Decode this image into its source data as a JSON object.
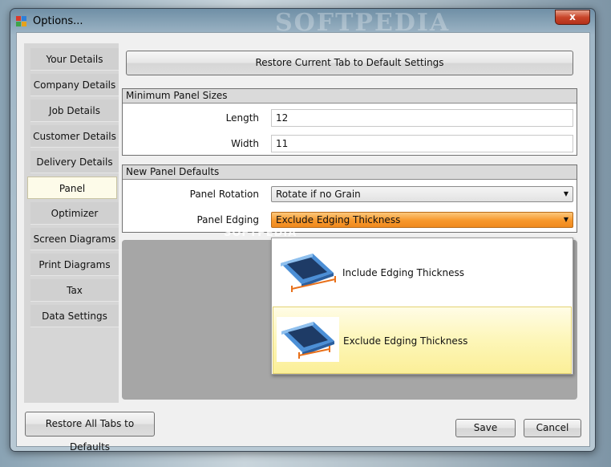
{
  "window": {
    "title": "Options...",
    "title_watermark": "SOFTPEDIA",
    "close_label": "x"
  },
  "sidebar": {
    "items": [
      {
        "label": "Your Details",
        "active": false
      },
      {
        "label": "Company Details",
        "active": false
      },
      {
        "label": "Job Details",
        "active": false
      },
      {
        "label": "Customer Details",
        "active": false
      },
      {
        "label": "Delivery Details",
        "active": false
      },
      {
        "label": "Panel",
        "active": true
      },
      {
        "label": "Optimizer",
        "active": false
      },
      {
        "label": "Screen Diagrams",
        "active": false
      },
      {
        "label": "Print Diagrams",
        "active": false
      },
      {
        "label": "Tax",
        "active": false
      },
      {
        "label": "Data Settings",
        "active": false
      }
    ]
  },
  "buttons": {
    "restore_tab": "Restore Current Tab to Default Settings",
    "restore_all": "Restore All Tabs to Defaults",
    "save": "Save",
    "cancel": "Cancel"
  },
  "min_panel_sizes": {
    "header": "Minimum Panel Sizes",
    "length_label": "Length",
    "length_value": "12",
    "width_label": "Width",
    "width_value": "11"
  },
  "new_panel_defaults": {
    "header": "New Panel Defaults",
    "rotation_label": "Panel Rotation",
    "rotation_value": "Rotate if no Grain",
    "edging_label": "Panel Edging",
    "edging_value": "Exclude Edging Thickness"
  },
  "edging_dropdown": {
    "watermark": "SOFTPEDIA",
    "options": [
      {
        "label": "Include Edging Thickness",
        "highlighted": false
      },
      {
        "label": "Exclude Edging Thickness",
        "highlighted": true
      }
    ]
  },
  "colors": {
    "active_tab": "#fdfbe9",
    "dropdown_open": "#f7972b",
    "hover_item": "#fbef98",
    "panel_face": "#1e3b66",
    "panel_edge": "#4c8fd6",
    "edging_arrow": "#e8701a"
  },
  "icons": {
    "app": "app-grid-icon",
    "dropdown_arrow": "chevron-down-icon",
    "include_edging": "panel-include-edging-icon",
    "exclude_edging": "panel-exclude-edging-icon"
  }
}
